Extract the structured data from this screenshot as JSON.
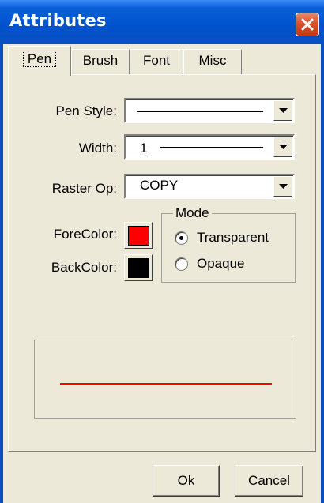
{
  "window": {
    "title": "Attributes"
  },
  "tabs": [
    {
      "label": "Pen",
      "active": true
    },
    {
      "label": "Brush",
      "active": false
    },
    {
      "label": "Font",
      "active": false
    },
    {
      "label": "Misc",
      "active": false
    }
  ],
  "pen": {
    "pen_style_label": "Pen Style:",
    "width_label": "Width:",
    "width_value": "1",
    "raster_op_label": "Raster Op:",
    "raster_op_value": "COPY",
    "forecolor_label": "ForeColor:",
    "forecolor": "#ff0000",
    "backcolor_label": "BackColor:",
    "backcolor": "#000000"
  },
  "mode": {
    "title": "Mode",
    "options": [
      {
        "label": "Transparent",
        "checked": true
      },
      {
        "label": "Opaque",
        "checked": false
      }
    ]
  },
  "preview": {
    "line_color": "#ff0000"
  },
  "buttons": {
    "ok_mnemonic": "O",
    "ok_rest": "k",
    "cancel_mnemonic": "C",
    "cancel_rest": "ancel"
  },
  "icons": {
    "close": "close-icon",
    "dropdown": "chevron-down-icon",
    "line_sample": "line-sample-icon"
  }
}
